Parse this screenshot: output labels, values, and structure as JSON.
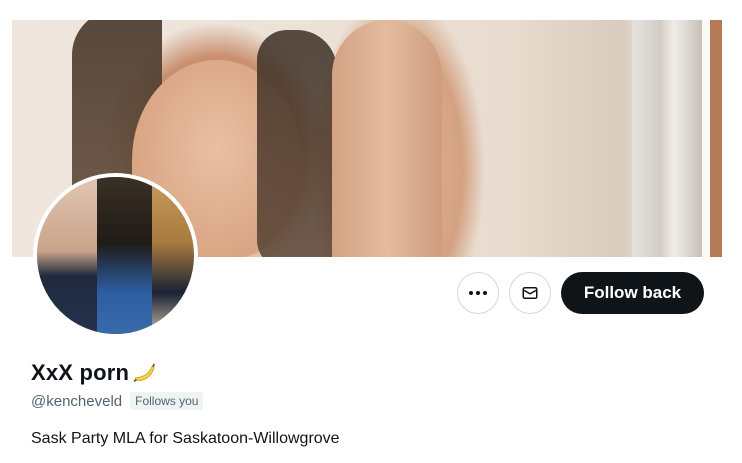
{
  "profile": {
    "display_name": "XxX porn",
    "name_emoji": "banana-emoji",
    "handle": "@kencheveld",
    "follows_you_label": "Follows you",
    "bio": "Sask Party MLA for Saskatoon-Willowgrove"
  },
  "actions": {
    "more_icon": "more-horizontal-icon",
    "message_icon": "envelope-icon",
    "follow_label": "Follow back"
  },
  "colors": {
    "primary_text": "#0f1419",
    "secondary_text": "#536471",
    "button_bg": "#0f1419",
    "border": "#cfd9de",
    "badge_bg": "#eff3f4"
  }
}
